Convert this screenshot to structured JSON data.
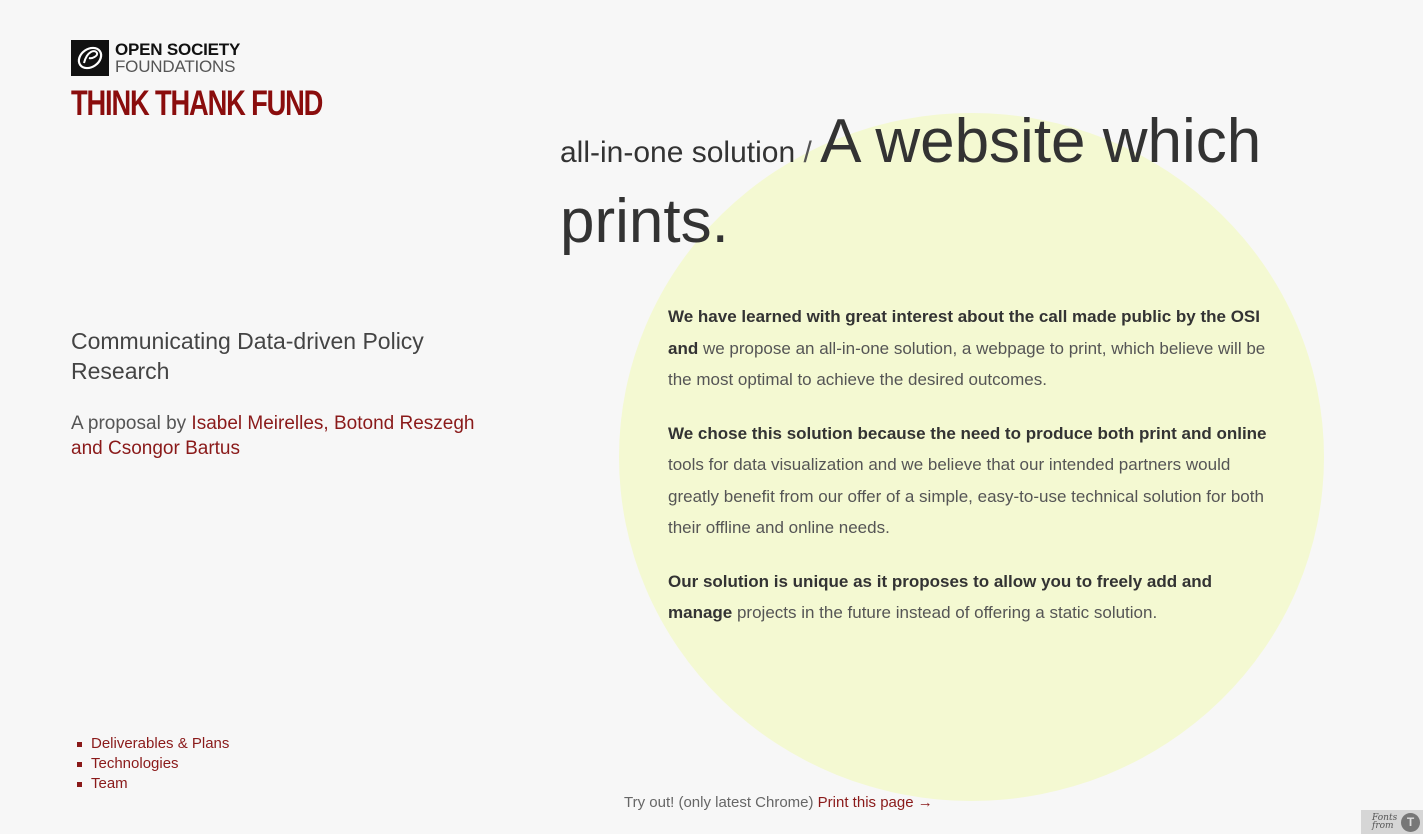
{
  "logo": {
    "line1": "OPEN SOCIETY",
    "line2": "FOUNDATIONS",
    "fund_title": "THINK THANK FUND"
  },
  "intro": {
    "subtitle": "Communicating Data-driven Policy Research",
    "byline_prefix": "A proposal by ",
    "author_1": "Isabel Meirelles",
    "separator": ", ",
    "author_2": "Botond Reszegh",
    "conjunction": " and ",
    "author_3": "Csongor Bartus"
  },
  "headline": {
    "kicker": "all-in-one solution",
    "slash": " / ",
    "main": "A website which prints."
  },
  "body": {
    "p1_bold": "We have learned with great interest about the call made public by the OSI and",
    "p1_rest": " we propose an all-in-one solution, a webpage to print, which believe will be the most optimal to achieve the desired outcomes.",
    "p2_bold": "We chose this solution because the need to produce both print and online",
    "p2_rest": " tools for data visualization and we believe that our intended partners would greatly benefit from our offer of a simple, easy-to-use technical solution for both their offline and online needs.",
    "p3_bold": "Our solution is unique as it proposes to allow you to freely add and manage",
    "p3_rest": " projects in the future instead of offering a static solution."
  },
  "nav": {
    "items": [
      {
        "label": "Deliverables & Plans"
      },
      {
        "label": "Technologies"
      },
      {
        "label": "Team"
      }
    ]
  },
  "footer": {
    "prefix": "Try out! (only latest Chrome) ",
    "print_link": "Print this page →"
  },
  "badge": {
    "line1": "Fonts",
    "line2": "from",
    "logo_glyph": "T"
  },
  "colors": {
    "accent": "#8a1a1a",
    "circle": "#f4f9d2",
    "background": "#f7f7f7"
  }
}
